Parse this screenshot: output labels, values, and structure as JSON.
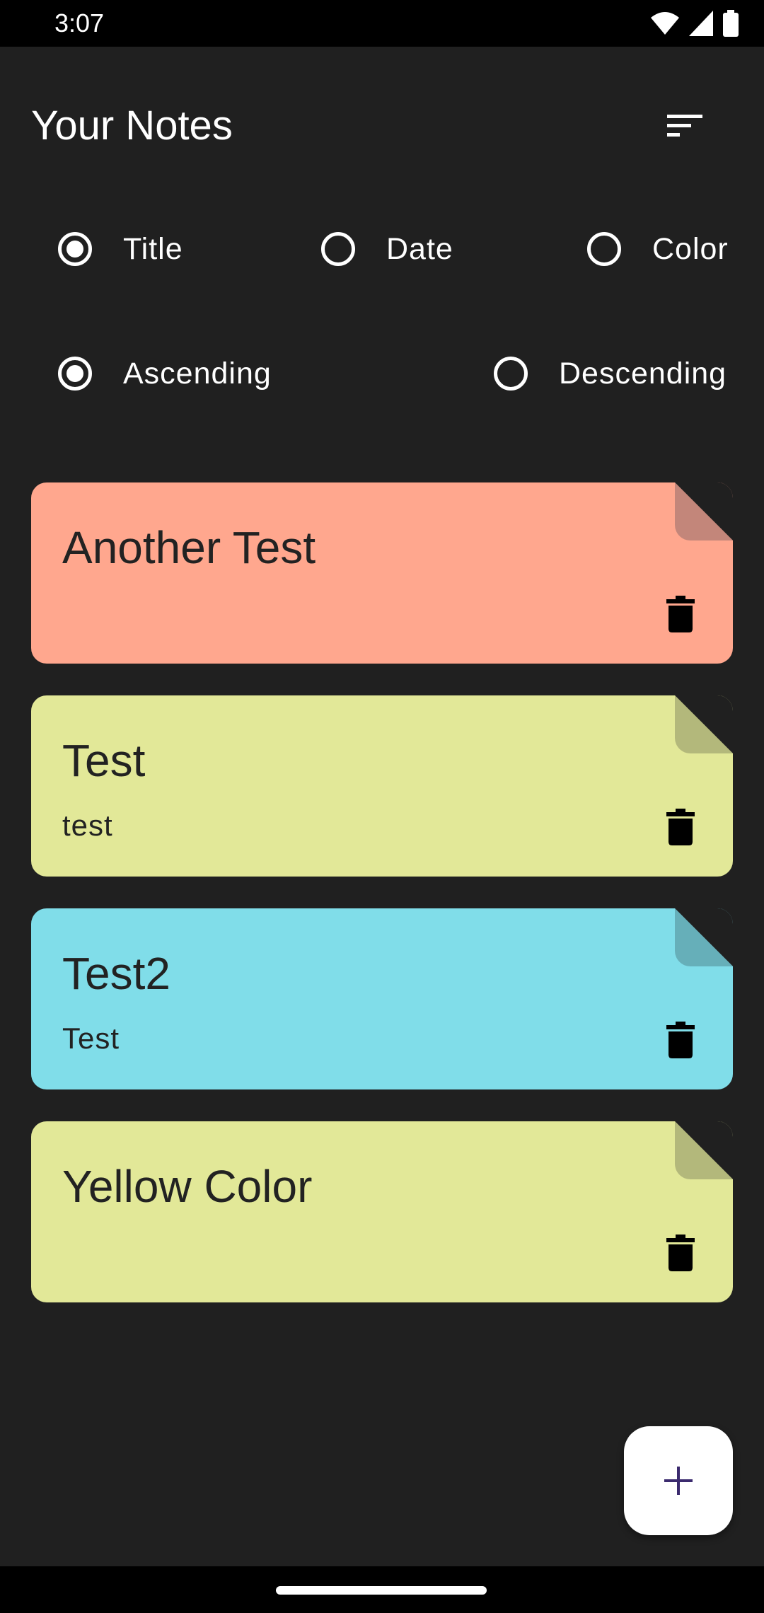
{
  "status_bar": {
    "time": "3:07",
    "icons": [
      "wifi-icon",
      "signal-icon",
      "battery-icon"
    ]
  },
  "header": {
    "title": "Your Notes",
    "sort_icon": "sort-icon"
  },
  "sort_by": {
    "options": [
      {
        "label": "Title",
        "selected": true
      },
      {
        "label": "Date",
        "selected": false
      },
      {
        "label": "Color",
        "selected": false
      }
    ]
  },
  "sort_order": {
    "options": [
      {
        "label": "Ascending",
        "selected": true
      },
      {
        "label": "Descending",
        "selected": false
      }
    ]
  },
  "notes": [
    {
      "title": "Another Test",
      "content": "",
      "color": "#FFA78E",
      "fold_color": "#C3867A"
    },
    {
      "title": "Test",
      "content": "test",
      "color": "#E2E898",
      "fold_color": "#B3B87B"
    },
    {
      "title": "Test2",
      "content": "Test",
      "color": "#80DDE9",
      "fold_color": "#66AFB9"
    },
    {
      "title": "Yellow Color",
      "content": "",
      "color": "#E2E898",
      "fold_color": "#B3B87B"
    }
  ],
  "fab": {
    "icon": "plus-icon",
    "icon_color": "#3B2A6E"
  }
}
